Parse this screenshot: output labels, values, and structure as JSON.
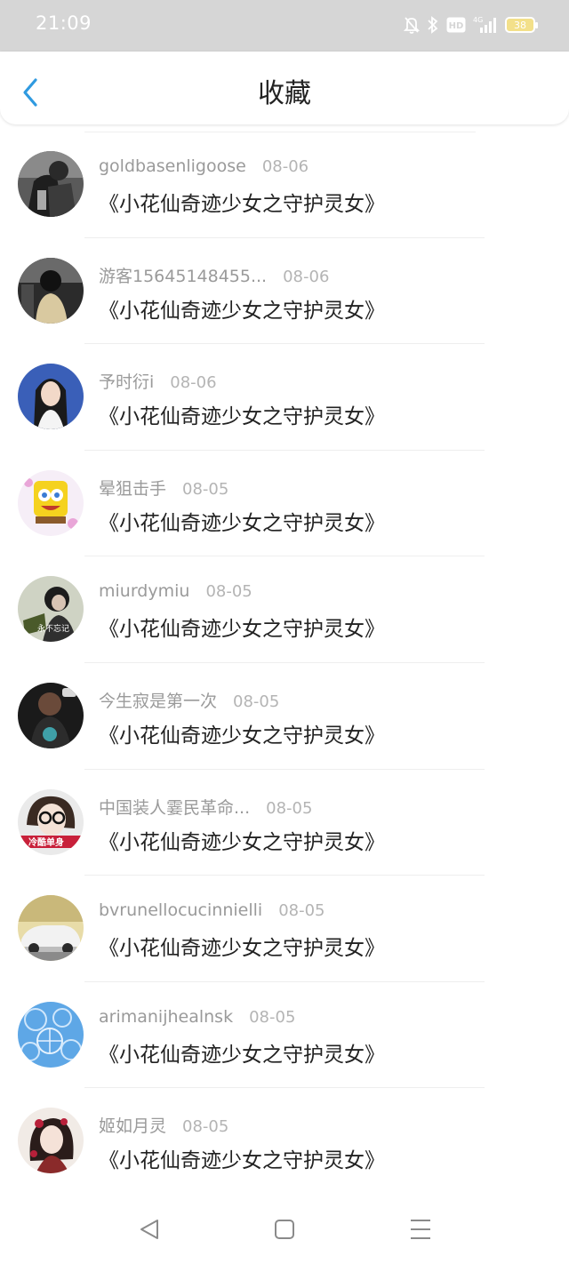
{
  "status_bar": {
    "time": "21:09",
    "icons": [
      "mute-bell-icon",
      "bluetooth-icon",
      "hd-icon",
      "signal-4g-icon",
      "battery-icon"
    ],
    "network": "4G",
    "hd_label": "HD",
    "battery_level": "38"
  },
  "header": {
    "title": "收藏",
    "back_icon": "chevron-left-icon",
    "accent_color": "#2f9ae0"
  },
  "favorites": [
    {
      "username": "goldbasenligoose",
      "date": "08-06",
      "title": "《小花仙奇迹少女之守护灵女》"
    },
    {
      "username": "游客15645148455...",
      "date": "08-06",
      "title": "《小花仙奇迹少女之守护灵女》"
    },
    {
      "username": "予时衍i",
      "date": "08-06",
      "title": "《小花仙奇迹少女之守护灵女》"
    },
    {
      "username": "晕狙击手",
      "date": "08-05",
      "title": "《小花仙奇迹少女之守护灵女》"
    },
    {
      "username": "miurdymiu",
      "date": "08-05",
      "title": "《小花仙奇迹少女之守护灵女》"
    },
    {
      "username": "今生寂是第一次",
      "date": "08-05",
      "title": "《小花仙奇迹少女之守护灵女》"
    },
    {
      "username": "中国装人霎民革命...",
      "date": "08-05",
      "title": "《小花仙奇迹少女之守护灵女》"
    },
    {
      "username": "bvrunellocucinnielli",
      "date": "08-05",
      "title": "《小花仙奇迹少女之守护灵女》"
    },
    {
      "username": "arimanijhealnsk",
      "date": "08-05",
      "title": "《小花仙奇迹少女之守护灵女》"
    },
    {
      "username": "姬如月灵",
      "date": "08-05",
      "title": "《小花仙奇迹少女之守护灵女》"
    }
  ],
  "avatar_badges": {
    "row5": "永不忘记",
    "row7": "冷酷单身"
  },
  "bottom_nav": {
    "icons": [
      "back-triangle-icon",
      "home-square-icon",
      "menu-lines-icon"
    ]
  }
}
